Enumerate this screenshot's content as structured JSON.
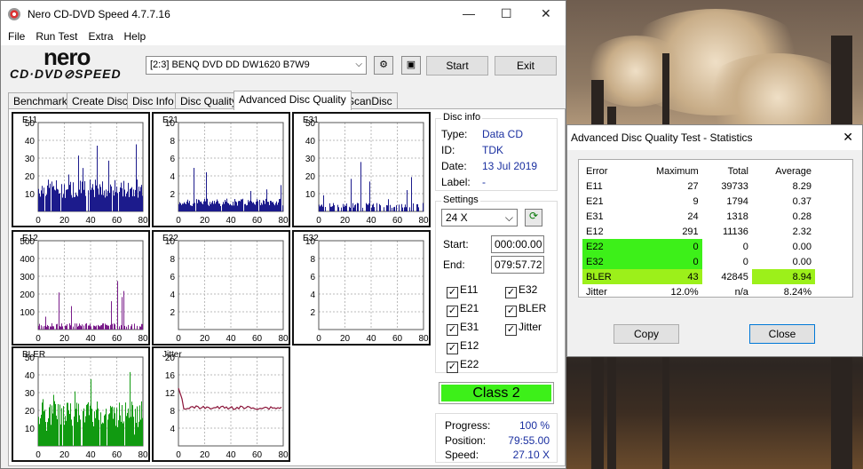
{
  "app": {
    "title": "Nero CD-DVD Speed 4.7.7.16",
    "logo_top": "nero",
    "logo_bottom": "CD·DVD⊘SPEED"
  },
  "menu": [
    "File",
    "Run Test",
    "Extra",
    "Help"
  ],
  "toolbar": {
    "drive": "[2:3]   BENQ DVD DD DW1620 B7W9",
    "start": "Start",
    "exit": "Exit"
  },
  "tabs": [
    "Benchmark",
    "Create Disc",
    "Disc Info",
    "Disc Quality",
    "Advanced Disc Quality",
    "ScanDisc"
  ],
  "colors": {
    "bars_blue": "#1c1b8c",
    "bars_purple": "#7a1d8a",
    "bars_green": "#119a11",
    "jitter": "#8a1338",
    "class_green": "#3df019",
    "avg_green": "#9cf01a"
  },
  "charts": [
    {
      "id": "E11",
      "title": "E11",
      "yticks": [
        "50",
        "40",
        "30",
        "20",
        "10"
      ],
      "xticks": [
        "0",
        "20",
        "40",
        "60",
        "80"
      ]
    },
    {
      "id": "E21",
      "title": "E21",
      "yticks": [
        "10",
        "8",
        "6",
        "4",
        "2"
      ],
      "xticks": [
        "0",
        "20",
        "40",
        "60",
        "80"
      ]
    },
    {
      "id": "E31",
      "title": "E31",
      "yticks": [
        "50",
        "40",
        "30",
        "20",
        "10"
      ],
      "xticks": [
        "0",
        "20",
        "40",
        "60",
        "80"
      ]
    },
    {
      "id": "E12",
      "title": "E12",
      "yticks": [
        "500",
        "400",
        "300",
        "200",
        "100"
      ],
      "xticks": [
        "0",
        "20",
        "40",
        "60",
        "80"
      ]
    },
    {
      "id": "E22",
      "title": "E22",
      "yticks": [
        "10",
        "8",
        "6",
        "4",
        "2"
      ],
      "xticks": [
        "0",
        "20",
        "40",
        "60",
        "80"
      ]
    },
    {
      "id": "E32",
      "title": "E32",
      "yticks": [
        "10",
        "8",
        "6",
        "4",
        "2"
      ],
      "xticks": [
        "0",
        "20",
        "40",
        "60",
        "80"
      ]
    },
    {
      "id": "BLER",
      "title": "BLER",
      "yticks": [
        "50",
        "40",
        "30",
        "20",
        "10"
      ],
      "xticks": [
        "0",
        "20",
        "40",
        "60",
        "80"
      ]
    },
    {
      "id": "Jitter",
      "title": "Jitter",
      "yticks": [
        "20",
        "16",
        "12",
        "8",
        "4"
      ],
      "xticks": [
        "0",
        "20",
        "40",
        "60",
        "80"
      ]
    }
  ],
  "disc_info": {
    "group": "Disc info",
    "type_label": "Type:",
    "type": "Data CD",
    "id_label": "ID:",
    "id": "TDK",
    "date_label": "Date:",
    "date": "13 Jul 2019",
    "label_label": "Label:",
    "label": "-"
  },
  "settings": {
    "group": "Settings",
    "speed": "24 X",
    "start_label": "Start:",
    "start": "000:00.00",
    "end_label": "End:",
    "end": "079:57.72",
    "checks": [
      "E11",
      "E32",
      "E21",
      "BLER",
      "E31",
      "Jitter",
      "E12",
      "E22"
    ]
  },
  "class": "Class 2",
  "progress": {
    "progress_label": "Progress:",
    "progress": "100 %",
    "position_label": "Position:",
    "position": "79:55.00",
    "speed_label": "Speed:",
    "speed": "27.10 X"
  },
  "dialog": {
    "title": "Advanced Disc Quality Test - Statistics",
    "copy": "Copy",
    "close": "Close",
    "headers": [
      "Error",
      "Maximum",
      "Total",
      "Average"
    ],
    "rows": [
      [
        "E11",
        "27",
        "39733",
        "8.29"
      ],
      [
        "E21",
        "9",
        "1794",
        "0.37"
      ],
      [
        "E31",
        "24",
        "1318",
        "0.28"
      ],
      [
        "E12",
        "291",
        "11136",
        "2.32"
      ],
      [
        "E22",
        "0",
        "0",
        "0.00"
      ],
      [
        "E32",
        "0",
        "0",
        "0.00"
      ],
      [
        "BLER",
        "43",
        "42845",
        "8.94"
      ],
      [
        "Jitter",
        "12.0%",
        "n/a",
        "8.24%"
      ]
    ]
  }
}
